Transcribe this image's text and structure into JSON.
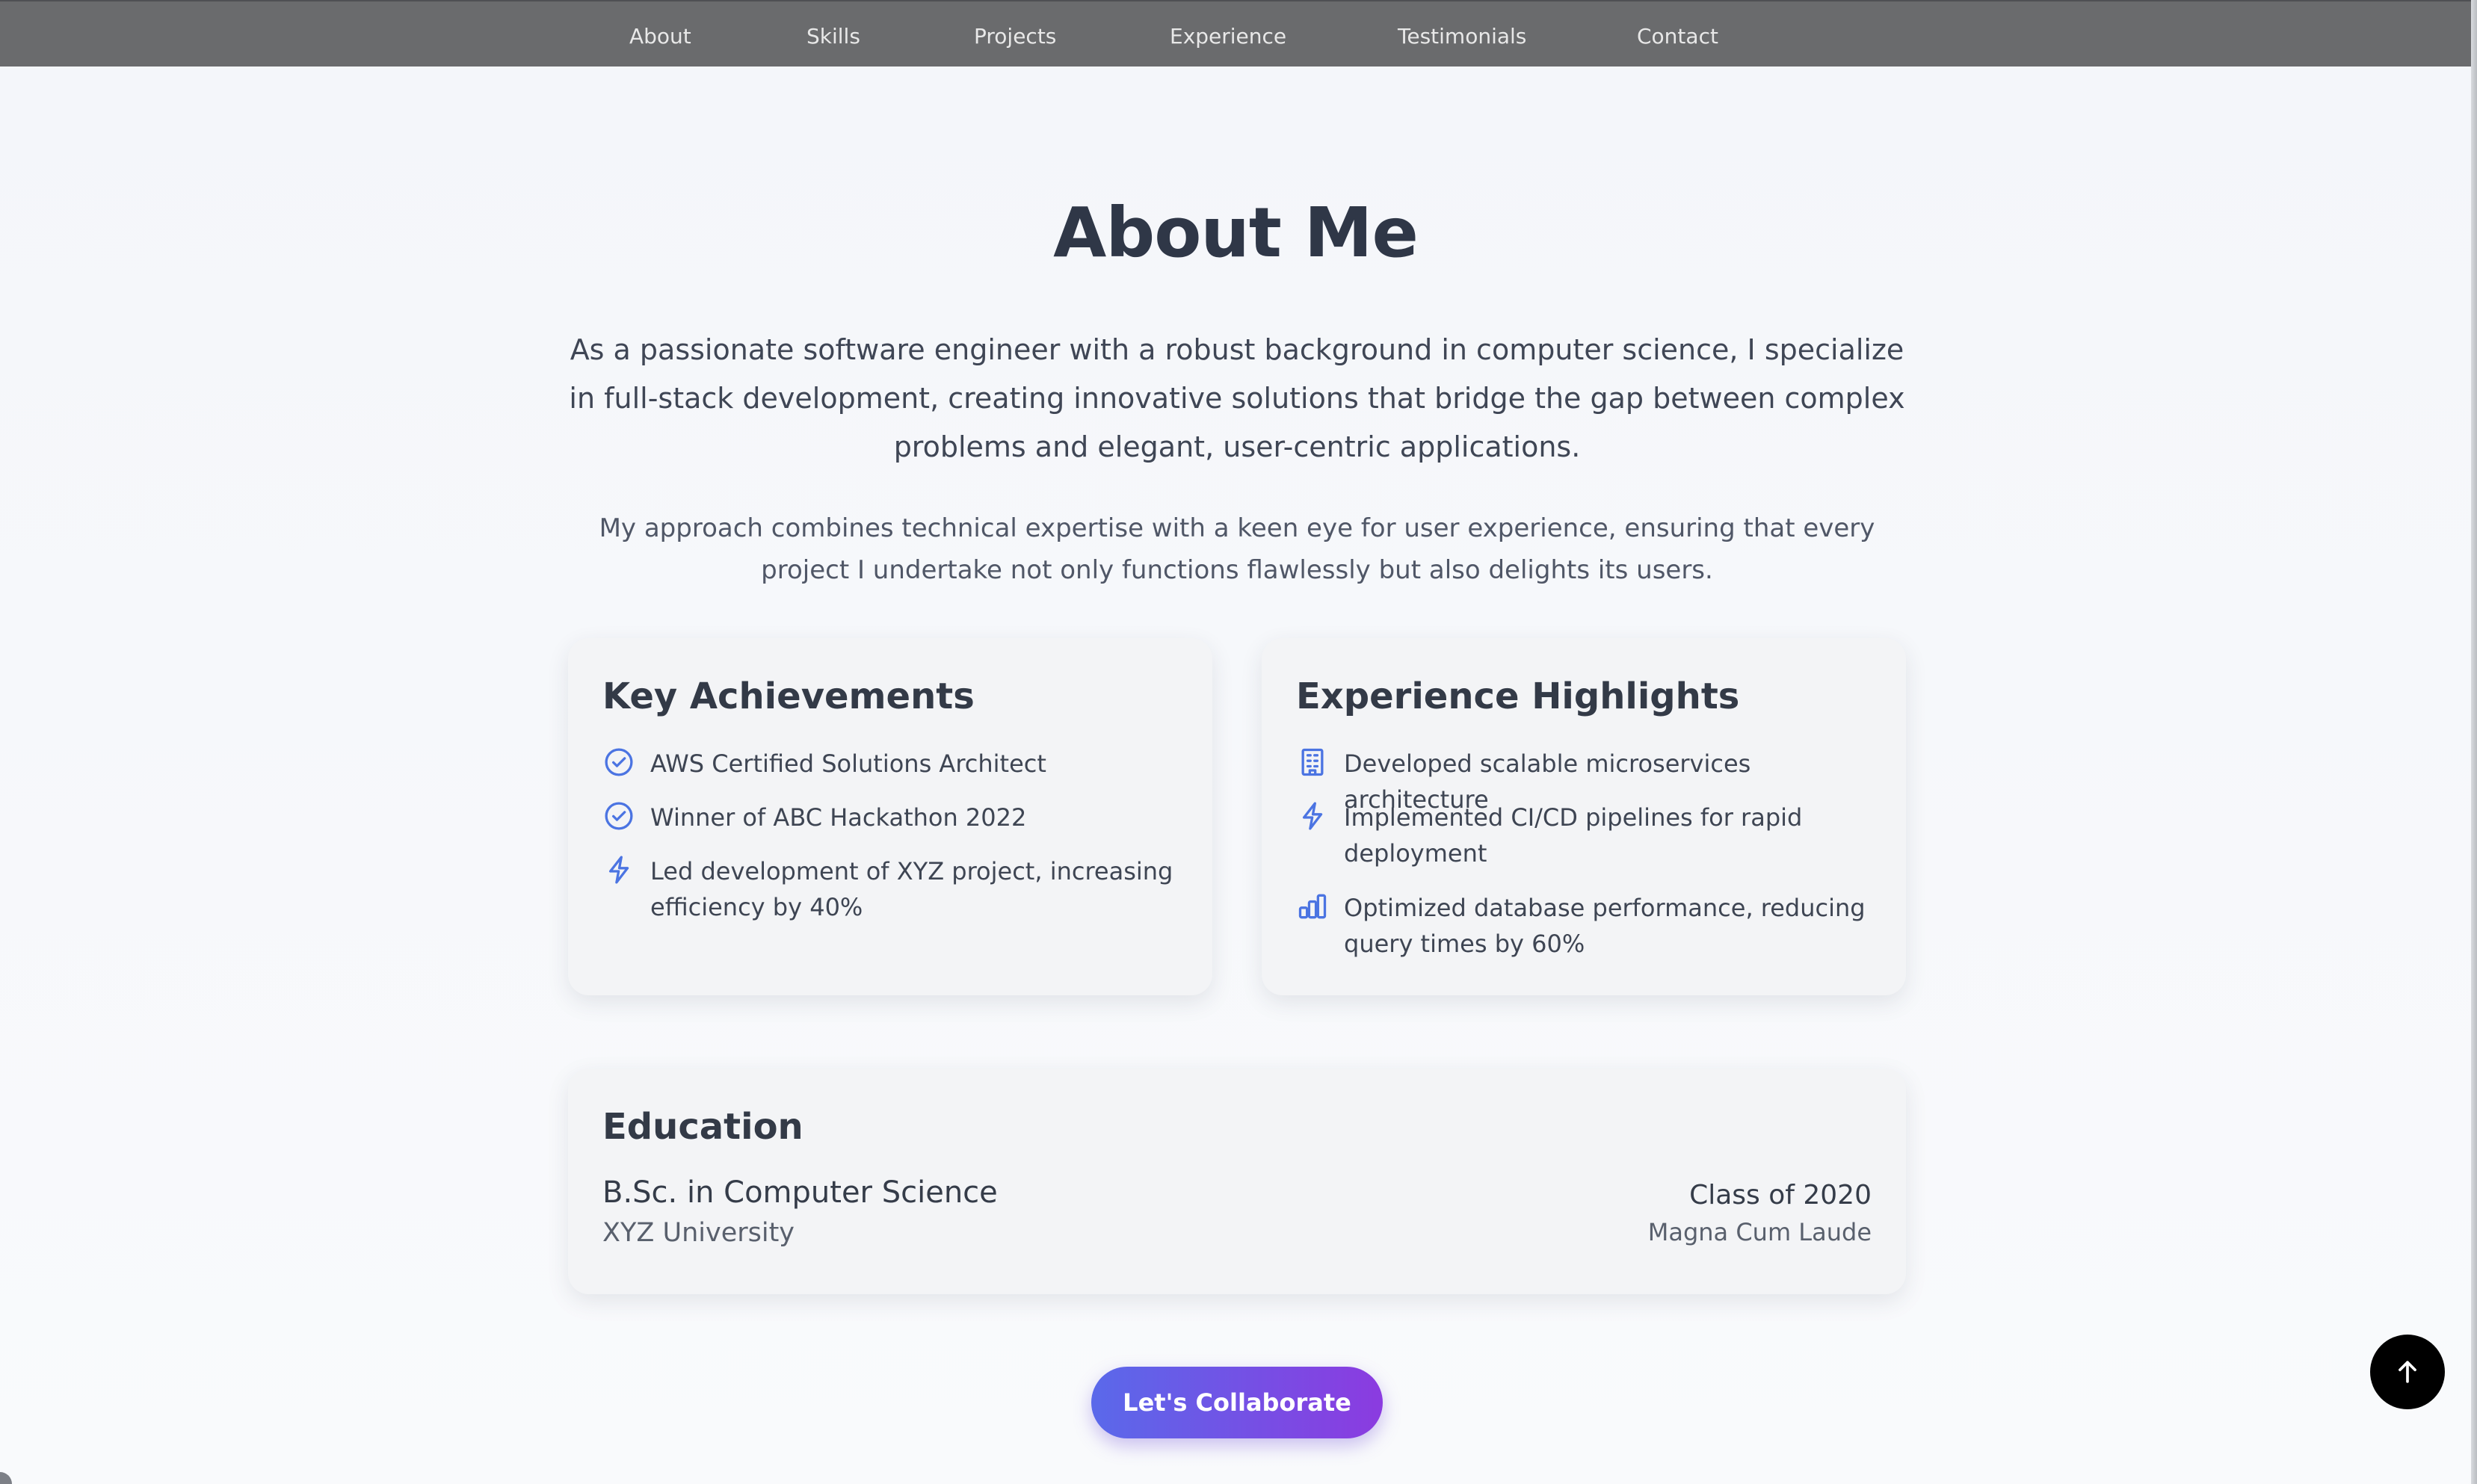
{
  "nav": {
    "items": [
      "About",
      "Skills",
      "Projects",
      "Experience",
      "Testimonials",
      "Contact"
    ]
  },
  "hero": {
    "title": "About Me",
    "lead": "As a passionate software engineer with a robust background in computer science, I specialize in full-stack development, creating innovative solutions that bridge the gap between complex problems and elegant, user-centric applications.",
    "sub": "My approach combines technical expertise with a keen eye for user experience, ensuring that every project I undertake not only functions flawlessly but also delights its users."
  },
  "achievements": {
    "title": "Key Achievements",
    "items": [
      {
        "icon": "check-circle-icon",
        "text": "AWS Certified Solutions Architect"
      },
      {
        "icon": "check-circle-icon",
        "text": "Winner of ABC Hackathon 2022"
      },
      {
        "icon": "lightning-icon",
        "text": "Led development of XYZ project, increasing efficiency by 40%"
      }
    ]
  },
  "experience": {
    "title": "Experience Highlights",
    "items": [
      {
        "icon": "building-icon",
        "text": "Developed scalable microservices architecture"
      },
      {
        "icon": "lightning-icon",
        "text": "Implemented CI/CD pipelines for rapid deployment"
      },
      {
        "icon": "bar-chart-icon",
        "text": "Optimized database performance, reducing query times by 60%"
      }
    ]
  },
  "education": {
    "title": "Education",
    "degree": "B.Sc. in Computer Science",
    "school": "XYZ University",
    "class_of": "Class of 2020",
    "honor": "Magna Cum Laude"
  },
  "cta": {
    "label": "Let's Collaborate"
  },
  "scroll_top": {
    "icon": "arrow-up-icon"
  },
  "colors": {
    "accent": "#4b74e2",
    "nav_bg": "#6a6b6d",
    "title": "#2f3747",
    "button_start": "#5a69ea",
    "button_end": "#8b3be0"
  }
}
